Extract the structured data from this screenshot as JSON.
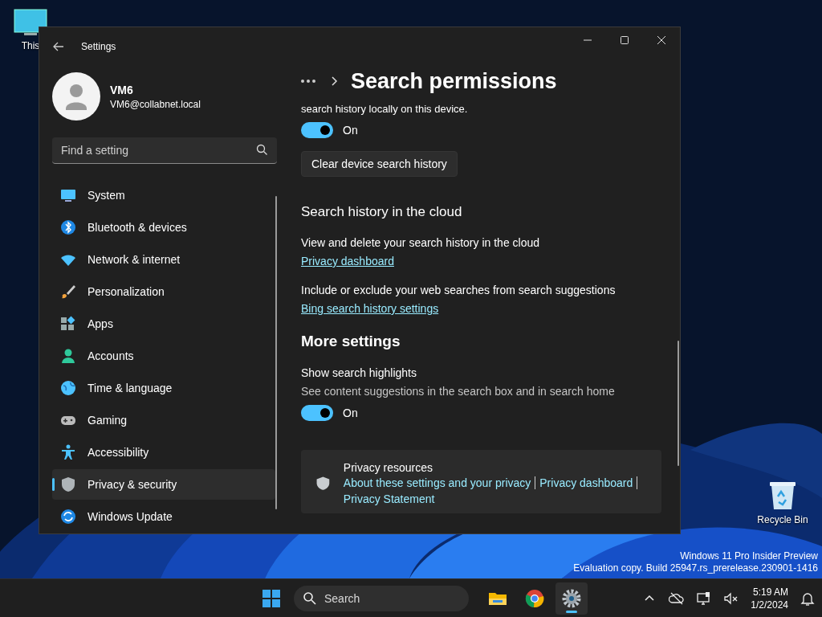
{
  "desktop": {
    "icons": [
      {
        "kind": "pc",
        "label": "This"
      },
      {
        "kind": "bin",
        "label": "Recycle Bin"
      }
    ],
    "watermark": [
      "Windows 11 Pro Insider Preview",
      "Evaluation copy. Build 25947.rs_prerelease.230901-1416"
    ]
  },
  "window": {
    "title": "Settings"
  },
  "account": {
    "name": "VM6",
    "email": "VM6@collabnet.local"
  },
  "search": {
    "placeholder": "Find a setting"
  },
  "nav": [
    {
      "label": "System",
      "selected": false
    },
    {
      "label": "Bluetooth & devices",
      "selected": false
    },
    {
      "label": "Network & internet",
      "selected": false
    },
    {
      "label": "Personalization",
      "selected": false
    },
    {
      "label": "Apps",
      "selected": false
    },
    {
      "label": "Accounts",
      "selected": false
    },
    {
      "label": "Time & language",
      "selected": false
    },
    {
      "label": "Gaming",
      "selected": false
    },
    {
      "label": "Accessibility",
      "selected": false
    },
    {
      "label": "Privacy & security",
      "selected": true
    },
    {
      "label": "Windows Update",
      "selected": false
    }
  ],
  "page": {
    "title": "Search permissions"
  },
  "content": [
    {
      "kind": "note",
      "text": "search history locally on this device."
    },
    {
      "kind": "toggle",
      "on": true,
      "label": "On"
    },
    {
      "kind": "button",
      "text": "Clear device search history"
    },
    {
      "kind": "heading",
      "text": "Search history in the cloud"
    },
    {
      "kind": "text",
      "text": "View and delete your search history in the cloud"
    },
    {
      "kind": "link",
      "text": "Privacy dashboard"
    },
    {
      "kind": "text",
      "text": "Include or exclude your web searches from search suggestions"
    },
    {
      "kind": "link",
      "text": "Bing search history settings"
    },
    {
      "kind": "section",
      "text": "More settings"
    },
    {
      "kind": "text",
      "text": "Show search highlights"
    },
    {
      "kind": "desc",
      "text": "See content suggestions in the search box and in search home"
    },
    {
      "kind": "toggle",
      "on": true,
      "label": "On"
    }
  ],
  "resources": {
    "title": "Privacy resources",
    "links": [
      "About these settings and your privacy",
      "Privacy dashboard",
      "Privacy Statement"
    ]
  },
  "taskbar": {
    "search": {
      "placeholder": "Search"
    },
    "apps": [
      {
        "kind": "explorer",
        "selected": false
      },
      {
        "kind": "chrome",
        "selected": false
      },
      {
        "kind": "settings",
        "selected": true
      }
    ],
    "time": "5:19 AM",
    "date": "1/2/2024"
  }
}
